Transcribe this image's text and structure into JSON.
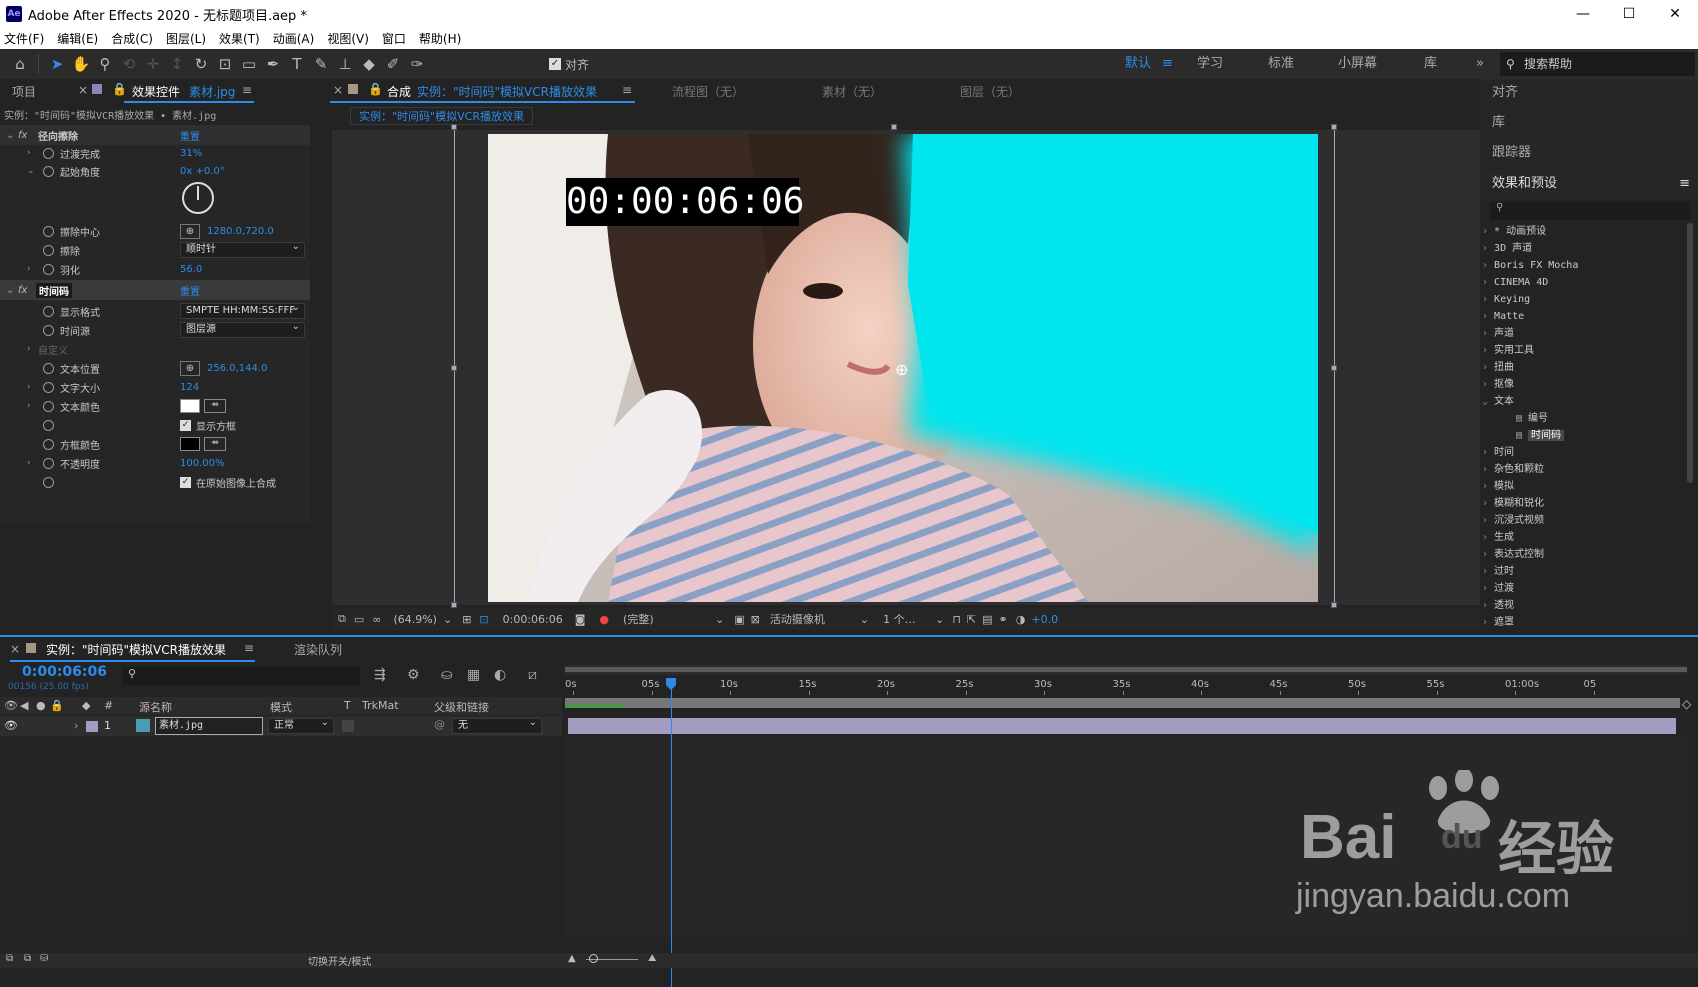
{
  "window": {
    "title": "Adobe After Effects 2020 - 无标题项目.aep *",
    "logo": "Ae",
    "min": "—",
    "max": "☐",
    "close": "✕"
  },
  "menu": [
    "文件(F)",
    "编辑(E)",
    "合成(C)",
    "图层(L)",
    "效果(T)",
    "动画(A)",
    "视图(V)",
    "窗口",
    "帮助(H)"
  ],
  "toolbar": {
    "align_label": "对齐",
    "workspaces": [
      "默认",
      "学习",
      "标准",
      "小屏幕",
      "库"
    ],
    "more": "»",
    "search_help": "搜索帮助"
  },
  "left_panel": {
    "tab_project": "项目",
    "tab_effects": "效果控件",
    "tab_effects_layer": "素材.jpg",
    "breadcrumb": "实例：\"时间码\"模拟VCR播放效果 • 素材.jpg",
    "effect1": {
      "name": "径向擦除",
      "reset": "重置",
      "props": [
        {
          "name": "过渡完成",
          "value": "31%"
        },
        {
          "name": "起始角度",
          "value": "0x +0.0°"
        },
        {
          "name": "擦除中心",
          "value": "1280.0,720.0"
        },
        {
          "name": "擦除",
          "value": "顺时针"
        },
        {
          "name": "羽化",
          "value": "56.0"
        }
      ]
    },
    "effect2": {
      "name": "时间码",
      "reset": "重置",
      "props": [
        {
          "name": "显示格式",
          "value": "SMPTE HH:MM:SS:FFF"
        },
        {
          "name": "时间源",
          "value": "图层源"
        },
        {
          "name": "自定义",
          "value": ""
        },
        {
          "name": "文本位置",
          "value": "256.0,144.0"
        },
        {
          "name": "文字大小",
          "value": "124"
        },
        {
          "name": "文本颜色",
          "value": ""
        },
        {
          "name": "",
          "value": "显示方框"
        },
        {
          "name": "方框颜色",
          "value": ""
        },
        {
          "name": "不透明度",
          "value": "100.00%"
        },
        {
          "name": "",
          "value": "在原始图像上合成"
        }
      ]
    }
  },
  "comp_panel": {
    "tab_label": "合成",
    "tab_name": "实例：\"时间码\"模拟VCR播放效果",
    "other_tabs": [
      "流程图（无）",
      "素材（无）",
      "图层（无）"
    ],
    "breadcrumb": "实例：\"时间码\"模拟VCR播放效果",
    "timecode_overlay": "00:00:06:06",
    "footer": {
      "zoom": "(64.9%)",
      "time": "0:00:06:06",
      "resolution": "(完整)",
      "camera": "活动摄像机",
      "views": "1 个…",
      "exposure": "+0.0"
    }
  },
  "right_panel": {
    "align": "对齐",
    "library": "库",
    "tracker": "跟踪器",
    "effects_presets": "效果和预设",
    "fx_items": [
      {
        "label": "* 动画预设"
      },
      {
        "label": "3D 声道"
      },
      {
        "label": "Boris FX Mocha"
      },
      {
        "label": "CINEMA 4D"
      },
      {
        "label": "Keying"
      },
      {
        "label": "Matte"
      },
      {
        "label": "声道"
      },
      {
        "label": "实用工具"
      },
      {
        "label": "扭曲"
      },
      {
        "label": "抠像"
      },
      {
        "label": "文本"
      },
      {
        "label": "编号"
      },
      {
        "label": "时间码"
      },
      {
        "label": "时间"
      },
      {
        "label": "杂色和颗粒"
      },
      {
        "label": "模拟"
      },
      {
        "label": "模糊和锐化"
      },
      {
        "label": "沉浸式视频"
      },
      {
        "label": "生成"
      },
      {
        "label": "表达式控制"
      },
      {
        "label": "过时"
      },
      {
        "label": "过渡"
      },
      {
        "label": "透视"
      },
      {
        "label": "遮罩"
      }
    ]
  },
  "timeline": {
    "tab_comp": "实例：\"时间码\"模拟VCR播放效果",
    "tab_render": "渲染队列",
    "current_time": "0:00:06:06",
    "frame_info": "00156 (25.00 fps)",
    "col_headers": {
      "num": "#",
      "source": "源名称",
      "mode": "模式",
      "t": "T",
      "trkmat": "TrkMat",
      "parent": "父级和链接"
    },
    "layer": {
      "index": "1",
      "name": "素材.jpg",
      "mode": "正常",
      "parent": "无"
    },
    "ruler": [
      "0s",
      "05s",
      "10s",
      "15s",
      "20s",
      "25s",
      "30s",
      "35s",
      "40s",
      "45s",
      "50s",
      "55s",
      "01:00s",
      "05"
    ],
    "playhead_seconds": 6.24,
    "bottom_label": "切换开关/模式"
  },
  "watermark": {
    "brand": "Bai",
    "paw": "du",
    "cn": "经验",
    "url": "jingyan.baidu.com"
  },
  "colors": {
    "accent": "#2d8ceb",
    "cyan_wipe": "#00e5ee",
    "layer_bar": "#a39bc0"
  }
}
